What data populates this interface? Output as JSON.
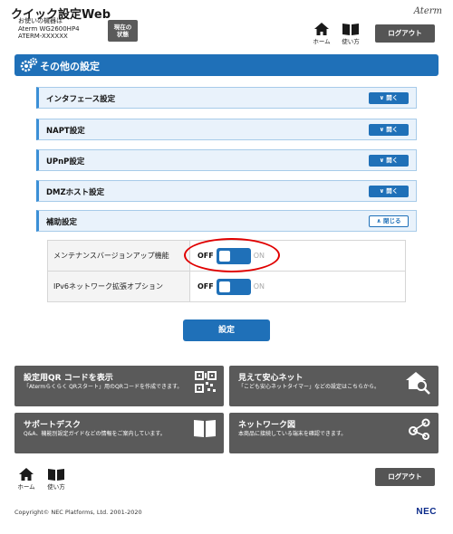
{
  "header": {
    "app_title": "クイック設定Web",
    "device_caption": "お使いの機器は",
    "device_model": "Aterm WG2600HP4",
    "device_id": "ATERM-XXXXXX",
    "status_button_line1": "現在の",
    "status_button_line2": "状態",
    "brand": "Aterm",
    "home_label": "ホーム",
    "manual_label": "使い方",
    "logout_label": "ログアウト"
  },
  "section": {
    "title": "その他の設定"
  },
  "accordion": [
    {
      "label": "インタフェース設定",
      "button": "開く",
      "open": false
    },
    {
      "label": "NAPT設定",
      "button": "開く",
      "open": false
    },
    {
      "label": "UPnP設定",
      "button": "開く",
      "open": false
    },
    {
      "label": "DMZホスト設定",
      "button": "開く",
      "open": false
    },
    {
      "label": "補助設定",
      "button": "閉じる",
      "open": true
    }
  ],
  "settings": [
    {
      "label": "メンテナンスバージョンアップ機能",
      "off_label": "OFF",
      "on_label": "ON",
      "state": "OFF"
    },
    {
      "label": "IPv6ネットワーク拡張オプション",
      "off_label": "OFF",
      "on_label": "ON",
      "state": "OFF"
    }
  ],
  "submit_label": "設定",
  "tiles": [
    {
      "title": "設定用QR コードを表示",
      "desc": "「Atermらくらく QRスタート」用のQRコードを作成できます。",
      "icon": "qr-code-icon"
    },
    {
      "title": "見えて安心ネット",
      "desc": "「こども安心ネットタイマー」などの設定はこちらから。",
      "icon": "home-search-icon"
    },
    {
      "title": "サポートデスク",
      "desc": "Q&A、機能別設定ガイドなどの情報をご案内しています。",
      "icon": "book-icon"
    },
    {
      "title": "ネットワーク図",
      "desc": "本商品に接続している端末を確認できます。",
      "icon": "network-icon"
    }
  ],
  "footer": {
    "home_label": "ホーム",
    "manual_label": "使い方",
    "logout_label": "ログアウト",
    "copyright": "Copyright© NEC Platforms, Ltd. 2001-2020",
    "vendor_logo": "NEC"
  },
  "colors": {
    "accent": "#1f70b8",
    "tile": "#5a5a5a",
    "highlight": "#e00000"
  }
}
